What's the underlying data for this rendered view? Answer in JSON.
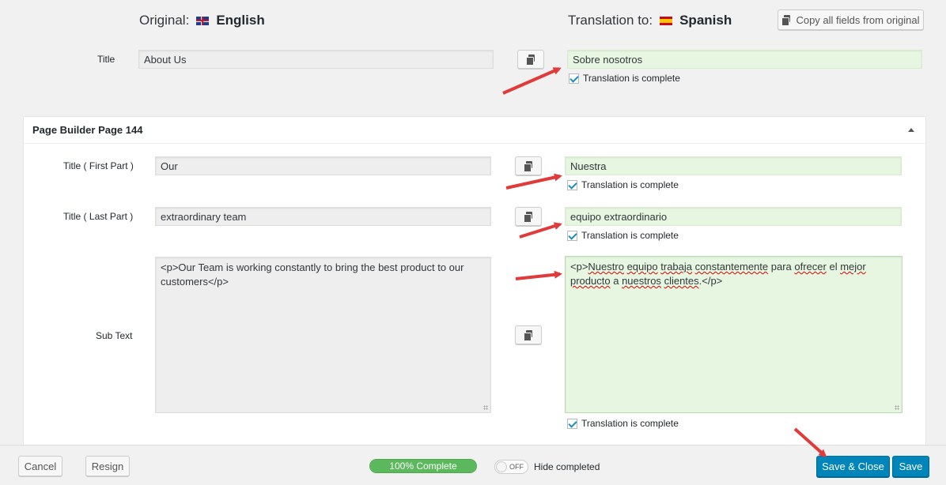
{
  "header": {
    "original_label": "Original:",
    "original_language": "English",
    "translation_label": "Translation to:",
    "translation_language": "Spanish",
    "copy_all_label": "Copy all fields from original"
  },
  "title_field": {
    "label": "Title",
    "original_value": "About Us",
    "translated_value": "Sobre nosotros",
    "complete_label": "Translation is complete",
    "complete_checked": true
  },
  "panel": {
    "title": "Page Builder Page 144",
    "fields": [
      {
        "label": "Title ( First Part )",
        "original_value": "Our",
        "translated_value": "Nuestra",
        "complete_label": "Translation is complete",
        "complete_checked": true
      },
      {
        "label": "Title ( Last Part )",
        "original_value": "extraordinary team",
        "translated_value": "equipo extraordinario",
        "complete_label": "Translation is complete",
        "complete_checked": true
      },
      {
        "label": "Sub Text",
        "original_value": "<p>Our Team is working constantly to bring the best product to our customers</p>",
        "translated_value": "<p>Nuestro equipo trabaja constantemente para ofrecer el mejor producto a nuestros clientes.</p>",
        "translated_words": {
          "w0": "<p>",
          "w1": "Nuestro",
          "w2": " ",
          "w3": "equipo",
          "w4": " ",
          "w5": "trabaja",
          "w6": " ",
          "w7": "constantemente",
          "w8": " para ",
          "w9": "ofrecer",
          "w10": " el ",
          "w11": "mejor",
          "w12": "producto",
          "w13": " a ",
          "w14": "nuestros",
          "w15": " ",
          "w16": "clientes",
          "w17": ".</p>"
        },
        "complete_label": "Translation is complete",
        "complete_checked": true
      }
    ]
  },
  "footer": {
    "cancel_label": "Cancel",
    "resign_label": "Resign",
    "progress_label": "100% Complete",
    "progress_fraction": 1.0,
    "toggle_label": "OFF",
    "hide_completed_label": "Hide completed",
    "save_close_label": "Save & Close",
    "save_label": "Save"
  },
  "colors": {
    "annotation_arrow": "#e03a3a",
    "translated_field_bg": "#e6f6e1",
    "primary_button": "#0085ba",
    "progress": "#5cb85c"
  }
}
